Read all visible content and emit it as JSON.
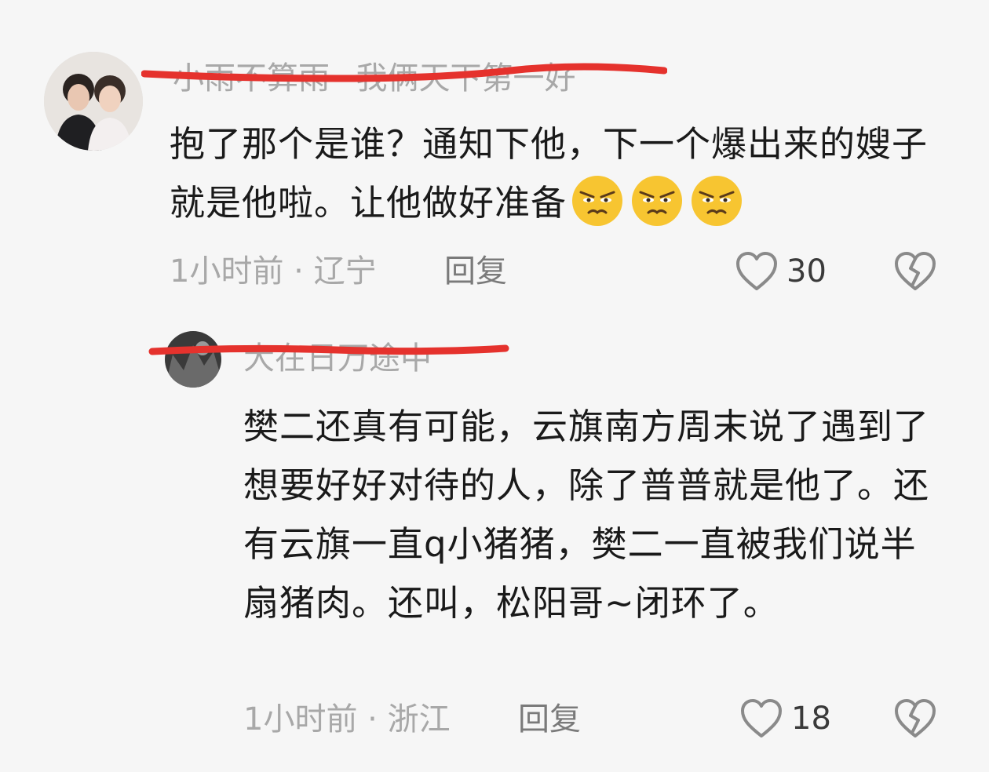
{
  "comments": [
    {
      "username": "小雨不算雨~我俩天下第一好",
      "text": "抱了那个是谁？通知下他，下一个爆出来的嫂子就是他啦。让他做好准备",
      "emojis": [
        "smirk-face-emoji",
        "smirk-face-emoji",
        "smirk-face-emoji"
      ],
      "time": "1小时前",
      "location": "辽宁",
      "reply_label": "回复",
      "likes": "30"
    },
    {
      "username": "大在日万途中",
      "text": "樊二还真有可能，云旗南方周末说了遇到了想要好好对待的人，除了普普就是他了。还有云旗一直q小猪猪，樊二一直被我们说半扇猪肉。还叫，松阳哥~闭环了。",
      "time": "1小时前",
      "location": "浙江",
      "reply_label": "回复",
      "likes": "18"
    }
  ],
  "meta_separator": "·",
  "icons": {
    "like": "heart-outline-icon",
    "dislike": "broken-heart-icon"
  },
  "colors": {
    "strike_red": "#e5322d",
    "muted_text": "#a8a8a8",
    "emoji_yellow": "#f7c531"
  }
}
